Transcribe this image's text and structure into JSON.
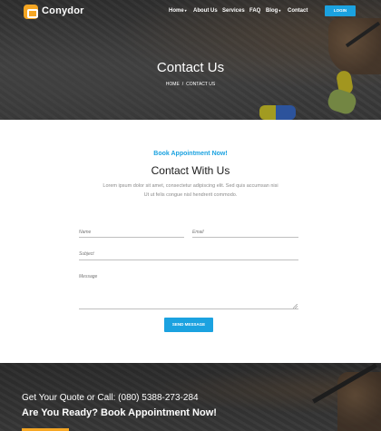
{
  "header": {
    "brand": "Conydor",
    "nav": [
      {
        "label": "Home",
        "has_dropdown": true
      },
      {
        "label": "About Us",
        "has_dropdown": false
      },
      {
        "label": "Services",
        "has_dropdown": false
      },
      {
        "label": "FAQ",
        "has_dropdown": false
      },
      {
        "label": "Blog",
        "has_dropdown": true
      },
      {
        "label": "Contact",
        "has_dropdown": false
      }
    ],
    "login_label": "LOGIN"
  },
  "hero": {
    "title": "Contact Us",
    "breadcrumb": [
      "HOME",
      "CONTACT US"
    ],
    "breadcrumb_sep": "/"
  },
  "form_section": {
    "subtitle": "Book Appointment Now!",
    "title": "Contact With Us",
    "description": "Lorem ipsum dolor sit amet, consectetur adipiscing elit. Sed quis accumsan nisi Ut ut felis congue nisl hendrerit commodo.",
    "fields": {
      "name_placeholder": "Name",
      "email_placeholder": "Email",
      "subject_placeholder": "Subject",
      "message_placeholder": "Message"
    },
    "submit_label": "SEND MESSAGE"
  },
  "cta": {
    "line1": "Get Your Quote or Call: (080) 5388-273-284",
    "line2": "Are You Ready? Book Appointment Now!"
  },
  "colors": {
    "accent": "#1ba2e0",
    "logo": "#f5a623"
  },
  "icons": {
    "logo": "construction-logo-icon",
    "dropdown": "caret-down-icon"
  }
}
